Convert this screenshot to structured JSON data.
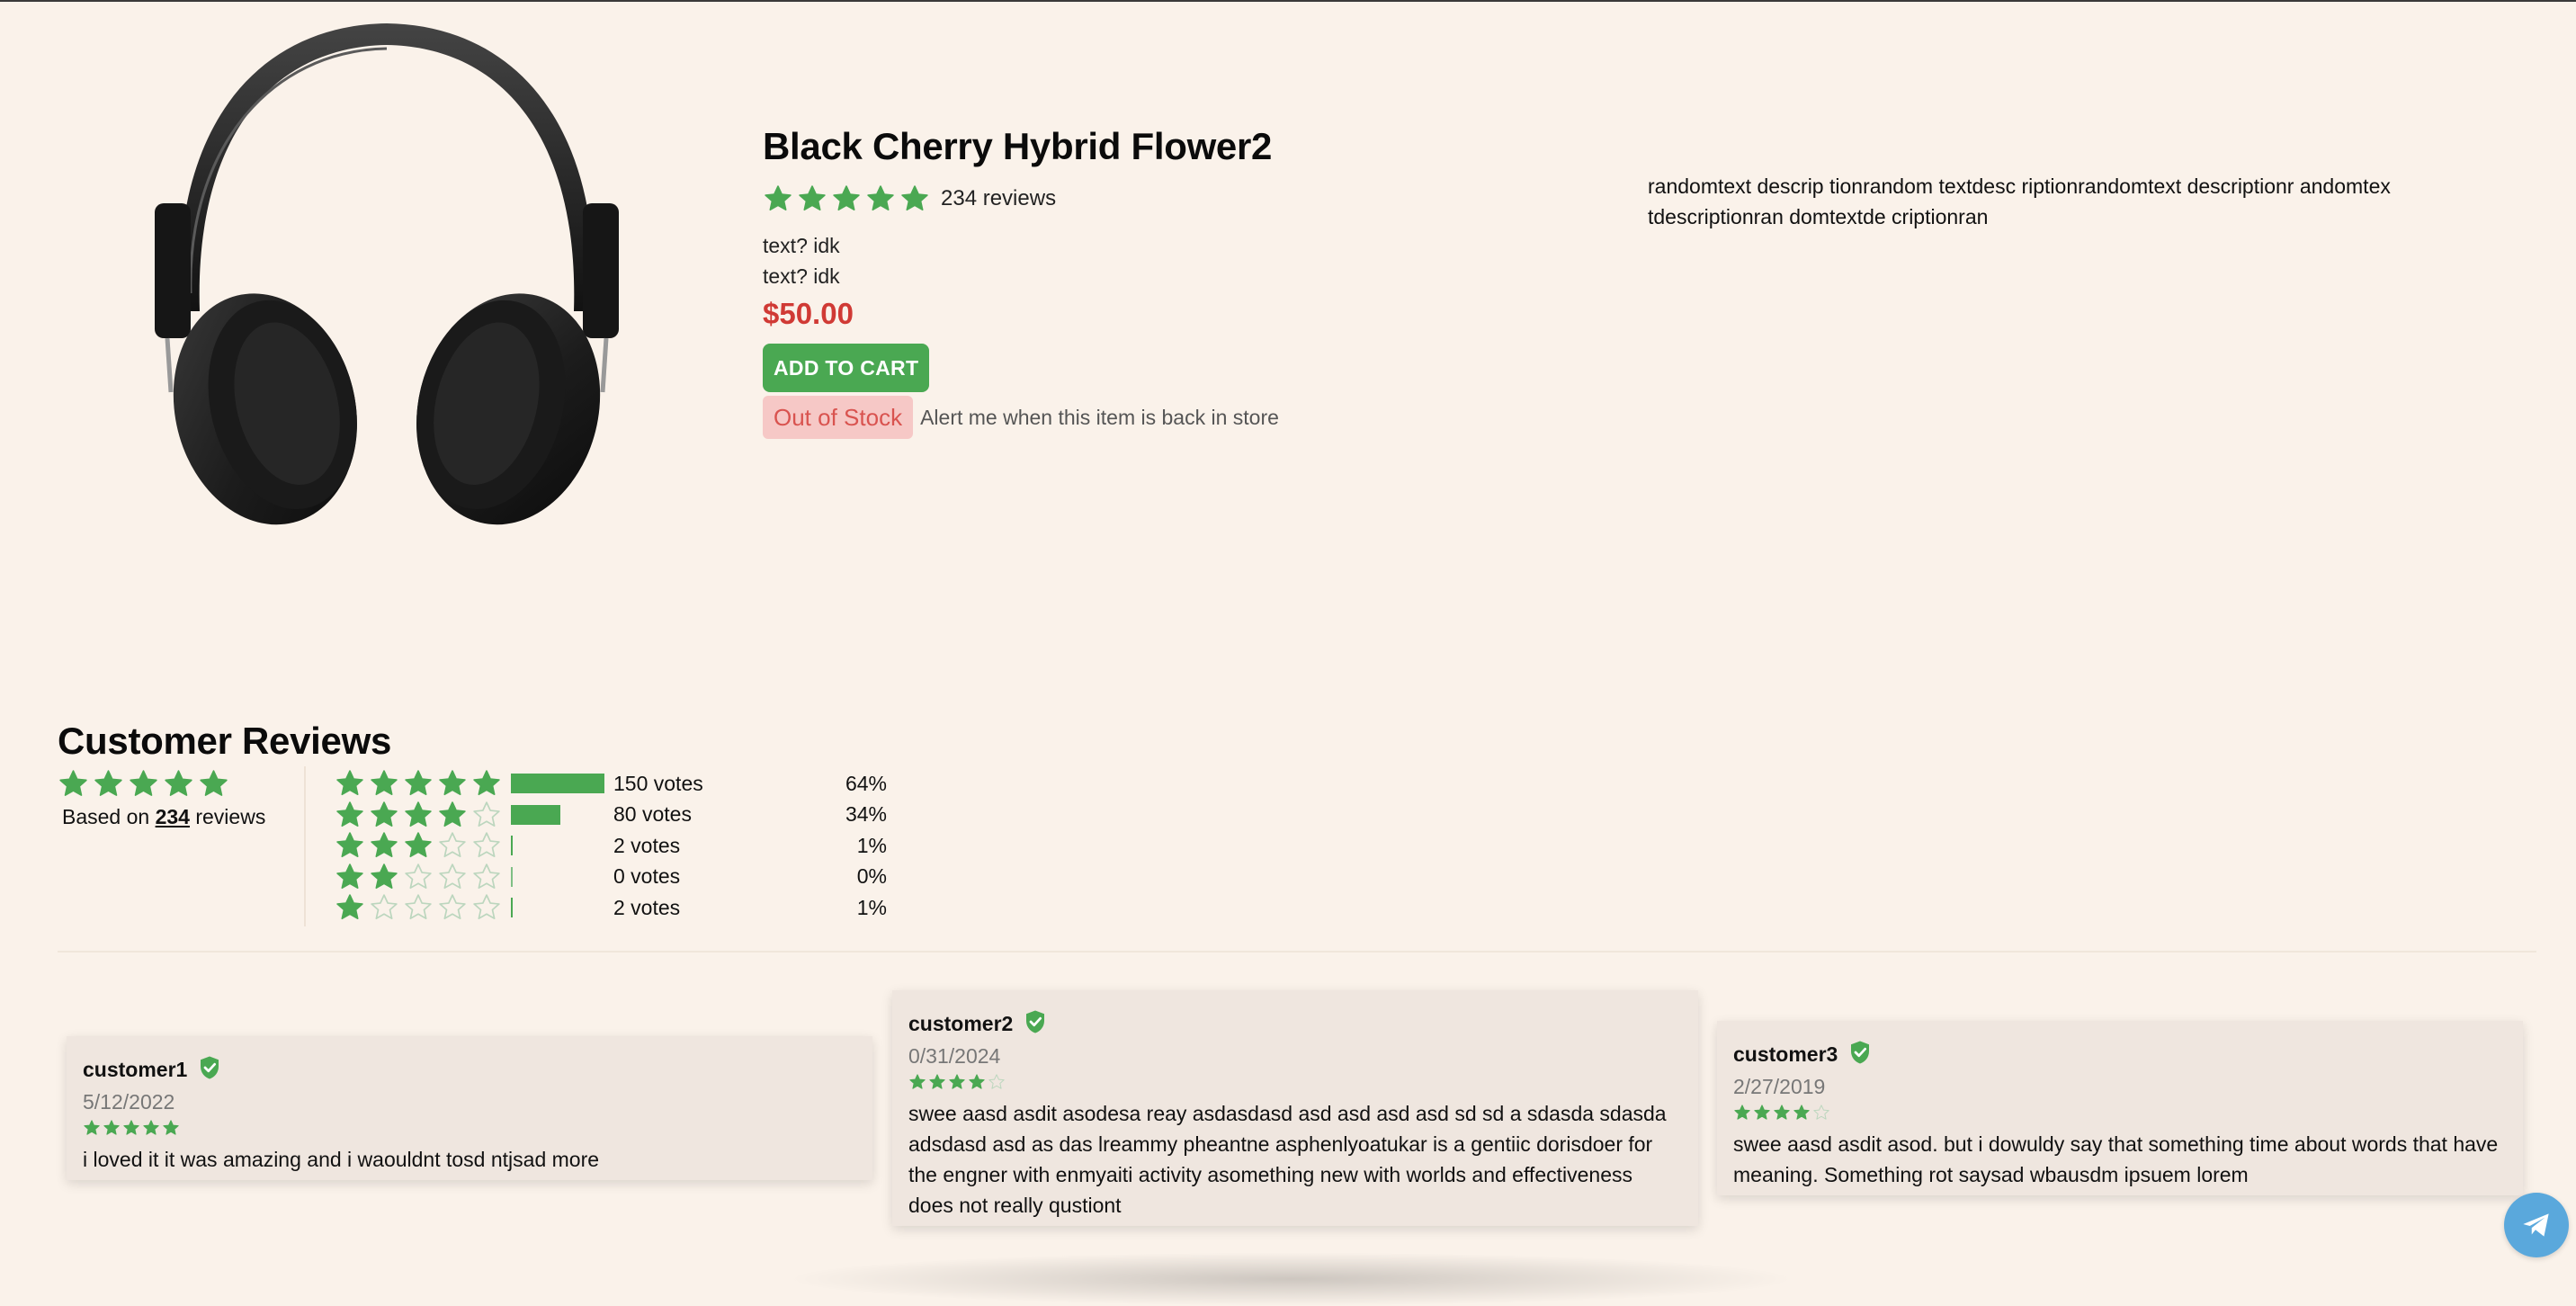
{
  "product": {
    "title": "Black Cherry Hybrid Flower2",
    "rating_stars": 5,
    "review_count_label": "234 reviews",
    "text_lines": [
      "text? idk",
      "text? idk"
    ],
    "price": "$50.00",
    "add_to_cart_label": "ADD TO CART",
    "stock_status": "Out of Stock",
    "alert_text": "Alert me when this item is back in store",
    "description": "randomtext descrip tionrandom textdesc riptionrandomtext descriptionr andomtex tdescriptionran domtextde criptionran",
    "image_alt": "headphones"
  },
  "reviews": {
    "heading": "Customer Reviews",
    "summary": {
      "stars": 5,
      "based_prefix": "Based on",
      "based_count": "234",
      "based_suffix": "reviews"
    },
    "breakdown": [
      {
        "stars": 5,
        "votes_label": "150 votes",
        "percent_label": "64%",
        "fraction": 1.0
      },
      {
        "stars": 4,
        "votes_label": "80 votes",
        "percent_label": "34%",
        "fraction": 0.53
      },
      {
        "stars": 3,
        "votes_label": "2 votes",
        "percent_label": "1%",
        "fraction": 0.013
      },
      {
        "stars": 2,
        "votes_label": "0 votes",
        "percent_label": "0%",
        "fraction": 0.0
      },
      {
        "stars": 1,
        "votes_label": "2 votes",
        "percent_label": "1%",
        "fraction": 0.013
      }
    ],
    "cards": [
      {
        "name": "customer1",
        "date": "5/12/2022",
        "stars": 5,
        "text": "i loved it it was amazing and i waouldnt tosd ntjsad more"
      },
      {
        "name": "customer2",
        "date": "0/31/2024",
        "stars": 4,
        "text": "swee aasd asdit asodesa reay asdasdasd asd asd asd asd sd sd a sdasda sdasda adsdasd asd as das lreammy pheantne asphenlyoatukar is a gentiic dorisdoer for the engner with enmyaiti activity asomething new with worlds and effectiveness does not really qustiont"
      },
      {
        "name": "customer3",
        "date": "2/27/2019",
        "stars": 4,
        "text": "swee aasd asdit asod. but i dowuldy say that something time about words that have meaning. Something rot saysad wbausdm ipsuem lorem"
      }
    ]
  },
  "colors": {
    "background": "#faf2ea",
    "accent_green": "#4aa852",
    "price_red": "#d03a35",
    "oos_bg": "#f6c8c6",
    "oos_text": "#d9534f",
    "card_bg": "#efe6df",
    "telegram_blue": "#5aa8dc"
  },
  "icons": {
    "star": "star-icon",
    "verified": "verified-shield-icon",
    "chat": "telegram-icon"
  }
}
